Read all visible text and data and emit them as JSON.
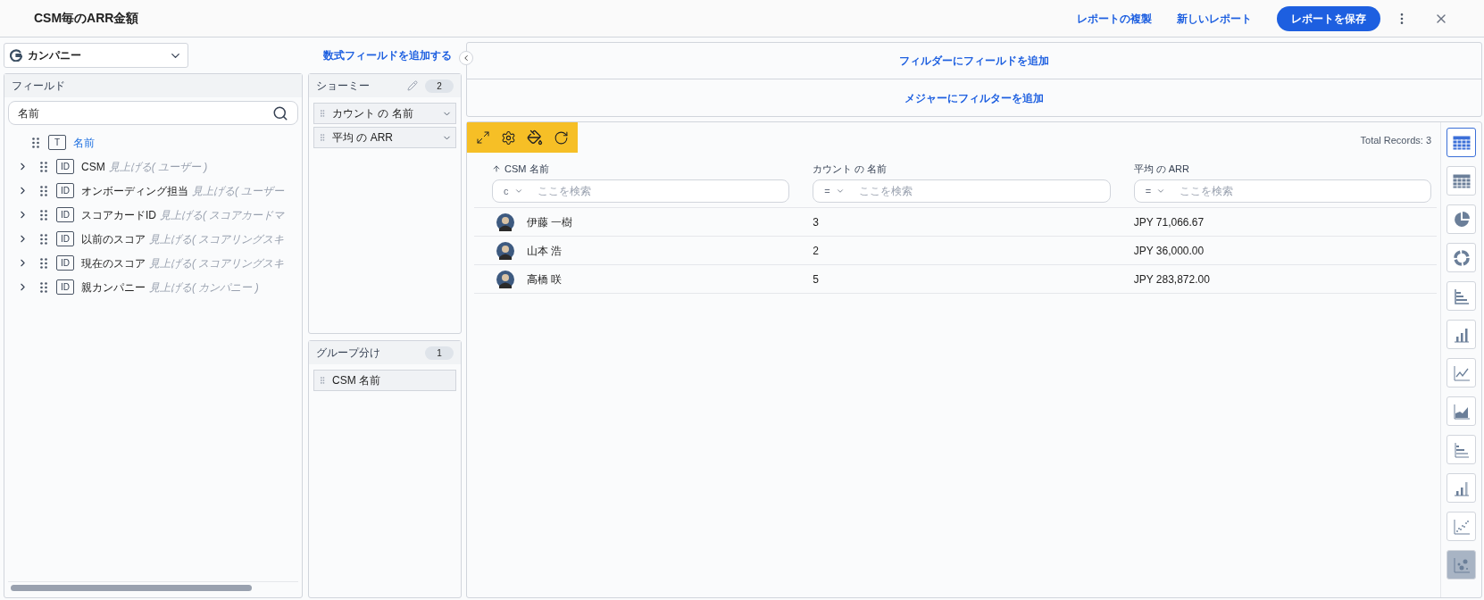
{
  "header": {
    "title": "CSM毎のARR金額",
    "actions": [
      {
        "label": "レポートの複製",
        "kind": "link"
      },
      {
        "label": "新しいレポート",
        "kind": "link"
      },
      {
        "label": "レポートを保存",
        "kind": "primary"
      }
    ]
  },
  "source": {
    "label": "カンパニー",
    "add_formula": "数式フィールドを追加する"
  },
  "fields": {
    "title": "フィールド",
    "search": {
      "value": "名前"
    },
    "items": [
      {
        "badge": "T",
        "label": "名前",
        "expandable": false,
        "selected": true
      },
      {
        "badge": "ID",
        "label": "CSM",
        "hint": "見上げる( ユーザー )",
        "expandable": true,
        "selected": false
      },
      {
        "badge": "ID",
        "label": "オンボーディング担当",
        "hint": "見上げる( ユーザー",
        "expandable": true,
        "selected": false
      },
      {
        "badge": "ID",
        "label": "スコアカードID",
        "hint": "見上げる( スコアカードマ",
        "expandable": true,
        "selected": false
      },
      {
        "badge": "ID",
        "label": "以前のスコア",
        "hint": "見上げる( スコアリングスキ",
        "expandable": true,
        "selected": false
      },
      {
        "badge": "ID",
        "label": "現在のスコア",
        "hint": "見上げる( スコアリングスキ",
        "expandable": true,
        "selected": false
      },
      {
        "badge": "ID",
        "label": "親カンパニー",
        "hint": "見上げる( カンパニー )",
        "expandable": true,
        "selected": false
      }
    ]
  },
  "show_me": {
    "title": "ショーミー",
    "count": "2",
    "items": [
      "カウント の 名前",
      "平均 の ARR"
    ]
  },
  "group_by": {
    "title": "グループ分け",
    "count": "1",
    "items": [
      "CSM 名前"
    ]
  },
  "filters": [
    "フィルダーにフィールドを追加",
    "メジャーにフィルターを追加"
  ],
  "table": {
    "total": "Total Records: 3",
    "columns": [
      {
        "label": "CSM 名前",
        "sorted": true,
        "operator": "c",
        "placeholder": "ここを検索"
      },
      {
        "label": "カウント の 名前",
        "sorted": false,
        "operator": "=",
        "placeholder": "ここを検索"
      },
      {
        "label": "平均 の ARR",
        "sorted": false,
        "operator": "=",
        "placeholder": "ここを検索"
      }
    ],
    "rows": [
      {
        "name": "伊藤 一樹",
        "count": "3",
        "arr": "JPY 71,066.67"
      },
      {
        "name": "山本 浩",
        "count": "2",
        "arr": "JPY 36,000.00"
      },
      {
        "name": "高橋 咲",
        "count": "5",
        "arr": "JPY 283,872.00"
      }
    ]
  },
  "chart_types": [
    {
      "kind": "table",
      "selected": true,
      "hovered": false
    },
    {
      "kind": "pivot",
      "selected": false,
      "hovered": false
    },
    {
      "kind": "pie",
      "selected": false,
      "hovered": false
    },
    {
      "kind": "donut",
      "selected": false,
      "hovered": false
    },
    {
      "kind": "hbar",
      "selected": false,
      "hovered": false
    },
    {
      "kind": "column",
      "selected": false,
      "hovered": false
    },
    {
      "kind": "line",
      "selected": false,
      "hovered": false
    },
    {
      "kind": "area",
      "selected": false,
      "hovered": false
    },
    {
      "kind": "hstack",
      "selected": false,
      "hovered": false
    },
    {
      "kind": "stack",
      "selected": false,
      "hovered": false
    },
    {
      "kind": "scatter",
      "selected": false,
      "hovered": false
    },
    {
      "kind": "bubble",
      "selected": false,
      "hovered": true
    }
  ]
}
